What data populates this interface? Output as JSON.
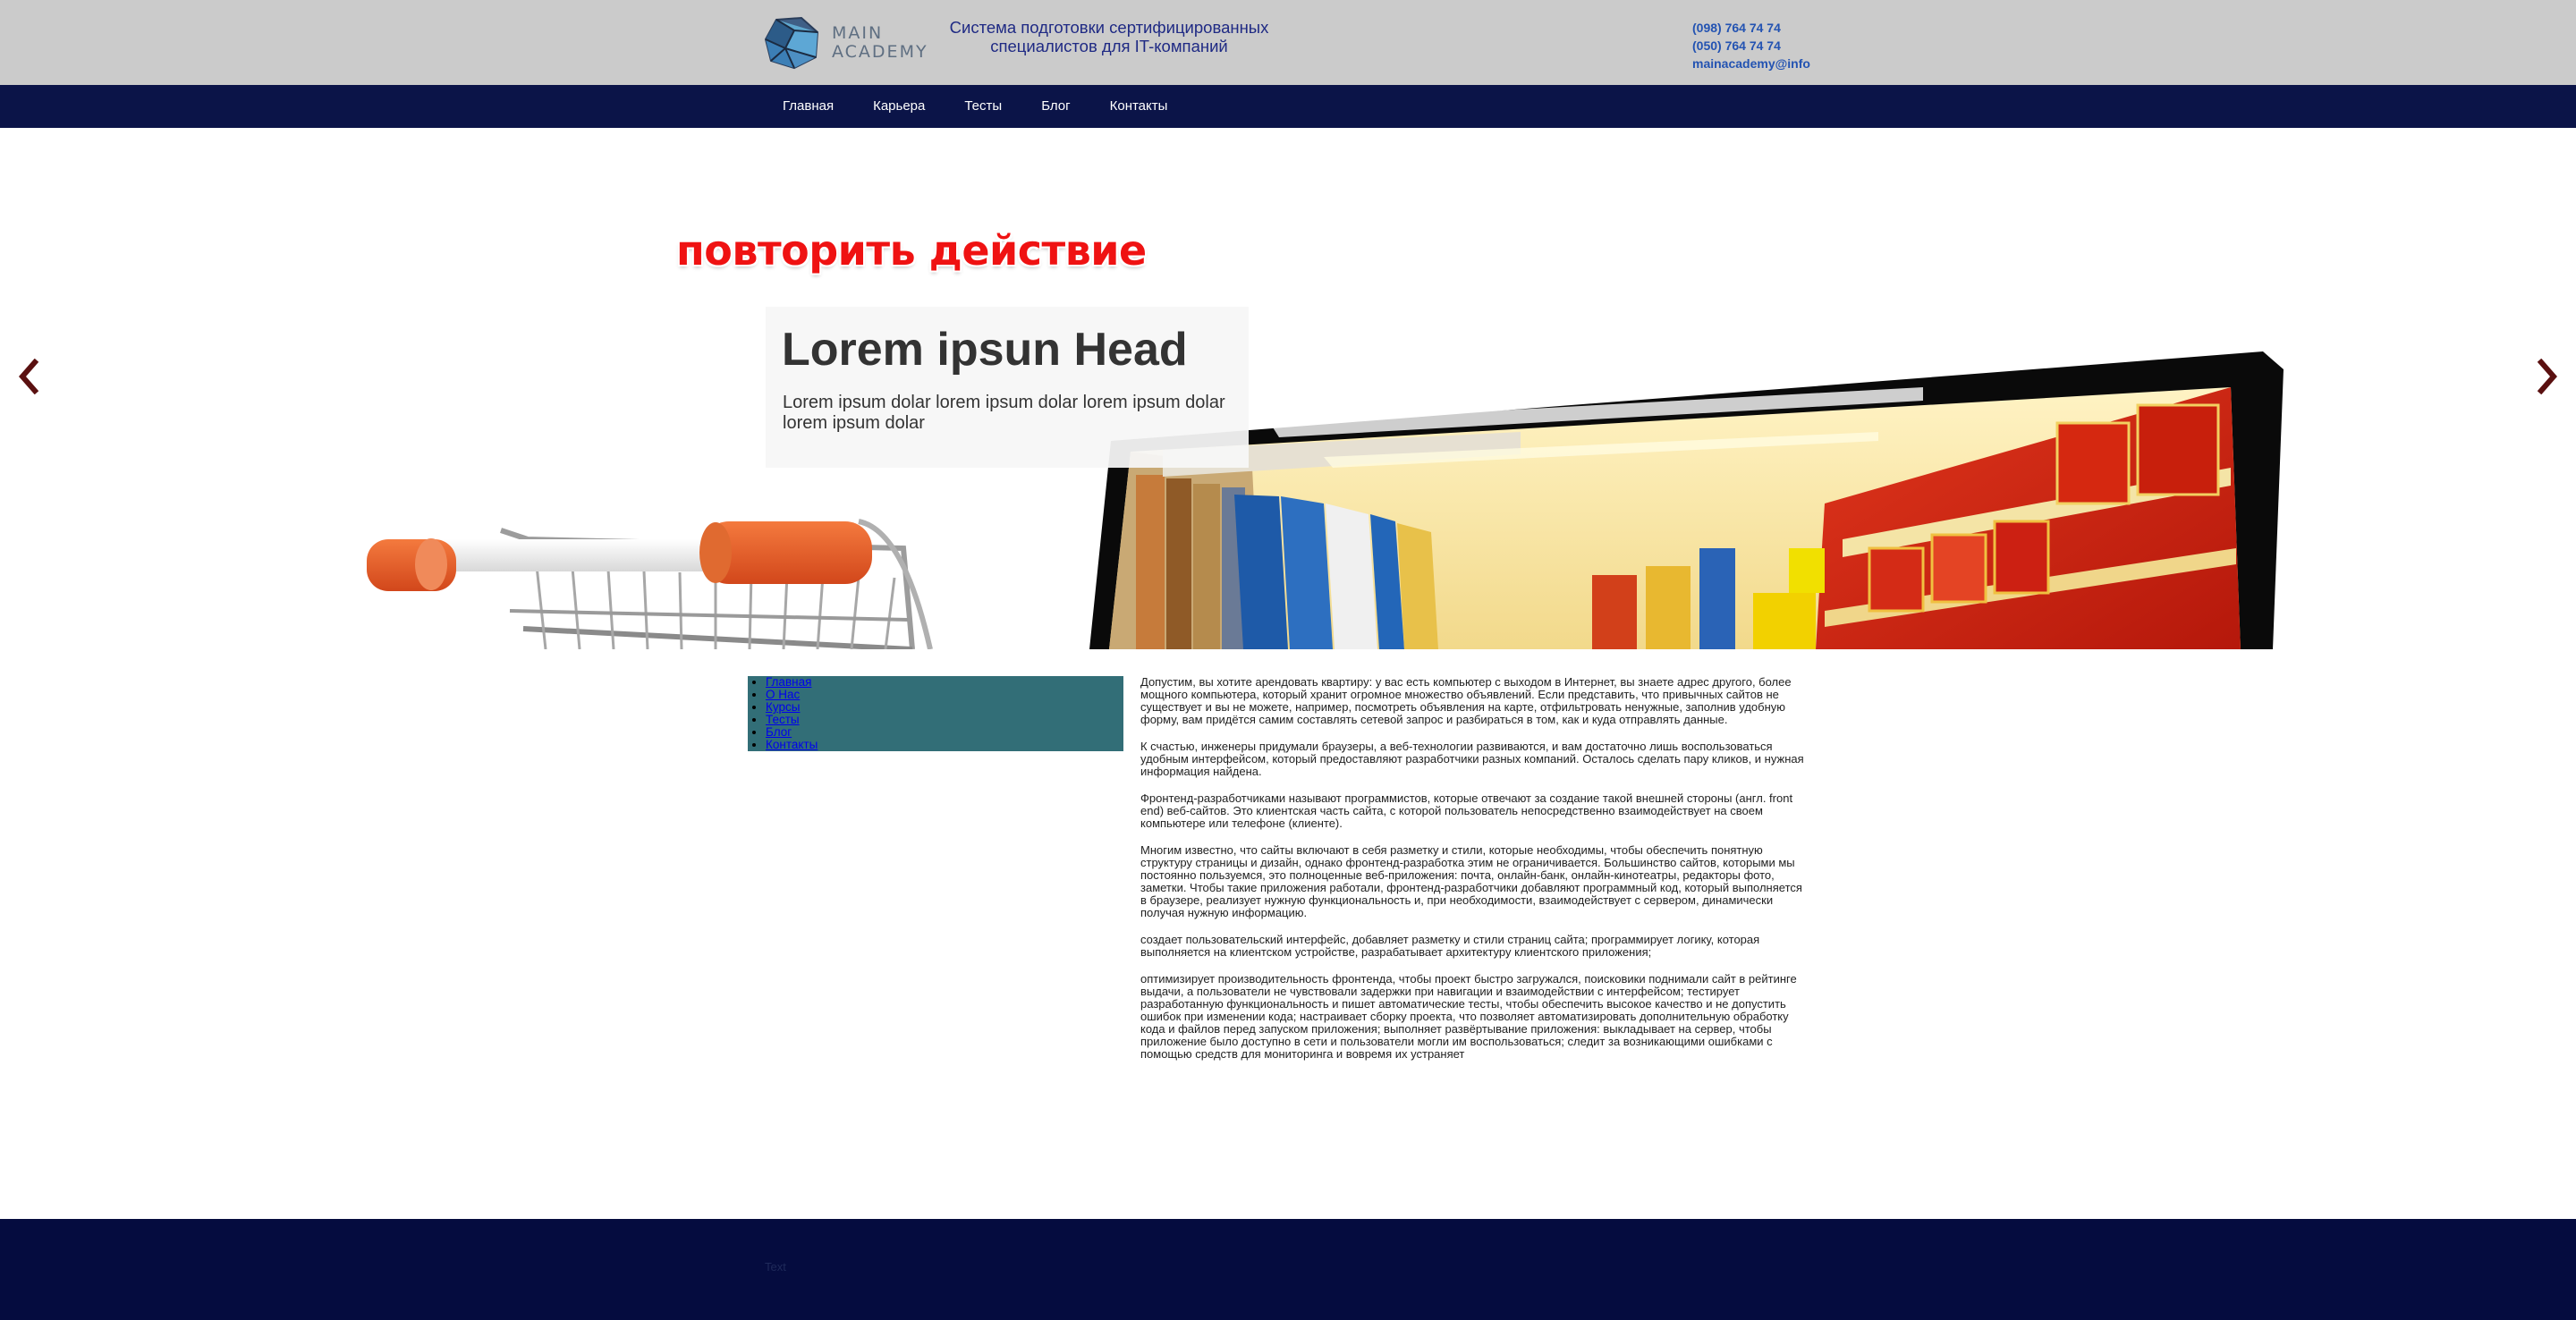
{
  "header": {
    "logo_text_line1": "MAIN",
    "logo_text_line2": "ACADEMY",
    "tagline": "Система подготовки сертифицированных специалистов для IT-компаний",
    "phone1": "(098) 764 74 74",
    "phone2": "(050) 764 74 74",
    "email": "mainacademy@info"
  },
  "nav": {
    "items": [
      {
        "label": "Главная"
      },
      {
        "label": "Карьера"
      },
      {
        "label": "Тесты"
      },
      {
        "label": "Блог"
      },
      {
        "label": "Контакты"
      }
    ]
  },
  "slider": {
    "overlay_text": "повторить действие",
    "title": "Lorem ipsun Head",
    "text": "Lorem ipsum dolar lorem ipsum dolar lorem ipsum dolar lorem ipsum dolar",
    "prev_icon": "chevron-left-icon",
    "next_icon": "chevron-right-icon"
  },
  "sidebar": {
    "items": [
      {
        "label": "Главная"
      },
      {
        "label": "О Нас"
      },
      {
        "label": "Курсы"
      },
      {
        "label": "Тесты"
      },
      {
        "label": "Блог"
      },
      {
        "label": "Контакты"
      }
    ]
  },
  "article": {
    "paragraphs": [
      "Допустим, вы хотите арендовать квартиру: у вас есть компьютер с выходом в Интернет, вы знаете адрес другого, более мощного компьютера, который хранит огромное множество объявлений. Если представить, что привычных сайтов не существует и вы не можете, например, посмотреть объявления на карте, отфильтровать ненужные, заполнив удобную форму, вам придётся самим составлять сетевой запрос и разбираться в том, как и куда отправлять данные.",
      "К счастью, инженеры придумали браузеры, а веб-технологии развиваются, и вам достаточно лишь воспользоваться удобным интерфейсом, который предоставляют разработчики разных компаний. Осталось сделать пару кликов, и нужная информация найдена.",
      "Фронтенд-разработчиками называют программистов, которые отвечают за создание такой внешней стороны (англ. front end) веб-сайтов. Это клиентская часть сайта, с которой пользователь непосредственно взаимодействует на своем компьютере или телефоне (клиенте).",
      "Многим известно, что сайты включают в себя разметку и стили, которые необходимы, чтобы обеспечить понятную структуру страницы и дизайн, однако фронтенд-разработка этим не ограничивается. Большинство сайтов, которыми мы постоянно пользуемся, это полноценные веб-приложения: почта, онлайн-банк, онлайн-кинотеатры, редакторы фото, заметки. Чтобы такие приложения работали, фронтенд-разработчики добавляют программный код, который выполняется в браузере, реализует нужную функциональность и, при необходимости, взаимодействует с сервером, динамически получая нужную информацию.",
      "создает пользовательский интерфейс, добавляет разметку и стили страниц сайта; программирует логику, которая выполняется на клиентском устройстве, разрабатывает архитектуру клиентского приложения;",
      "оптимизирует производительность фронтенда, чтобы проект быстро загружался, поисковики поднимали сайт в рейтинге выдачи, а пользователи не чувствовали задержки при навигации и взаимодействии с интерфейсом; тестирует разработанную функциональность и пишет автоматические тесты, чтобы обеспечить высокое качество и не допустить ошибок при изменении кода; настраивает сборку проекта, что позволяет автоматизировать дополнительную обработку кода и файлов перед запуском приложения; выполняет развёртывание приложения: выкладывает на сервер, чтобы приложение было доступно в сети и пользователи могли им воспользоваться; следит за возникающими ошибками с помощью средств для мониторинга и вовремя их устраняет"
    ]
  },
  "footer": {
    "text": "Text"
  },
  "colors": {
    "header_bg": "#cbcbcb",
    "nav_bg": "#0b1448",
    "sidebar_bg": "#326e77",
    "footer_bg": "#050c3f",
    "tagline": "#1f2a84",
    "contacts": "#2353b2",
    "overlay_red": "#ef1212",
    "arrow": "#5a1010"
  }
}
